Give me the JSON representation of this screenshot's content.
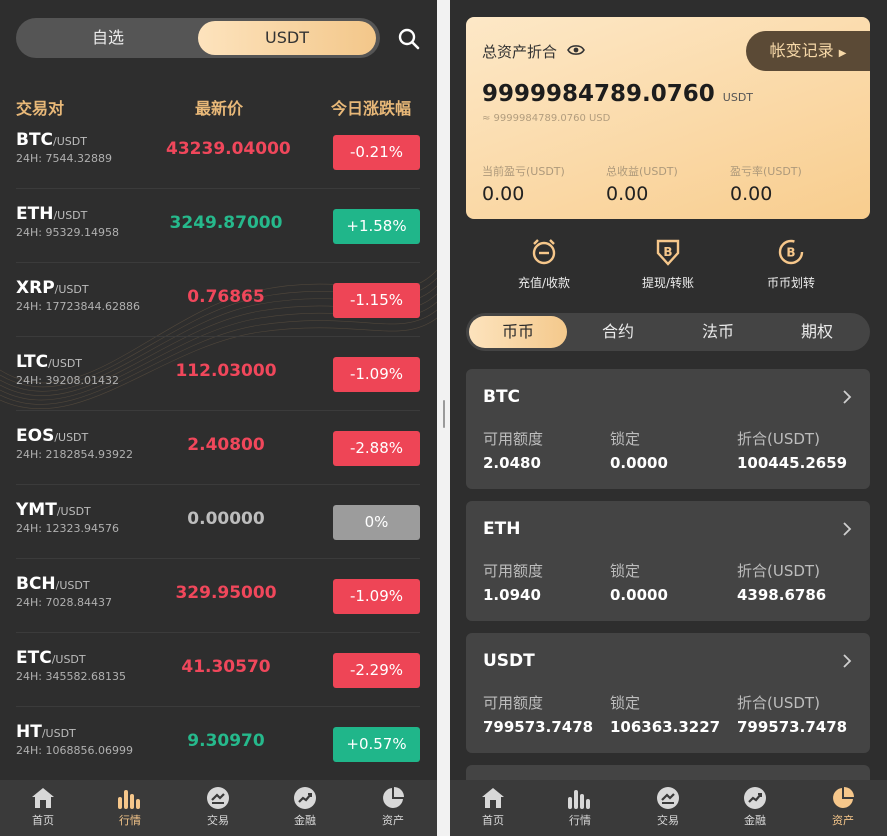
{
  "market": {
    "toggle": [
      "自选",
      "USDT"
    ],
    "headers": [
      "交易对",
      "最新价",
      "今日涨跌幅"
    ],
    "rows": [
      {
        "base": "BTC",
        "quote": "/USDT",
        "vol": "24H: 7544.32889",
        "price": "43239.04000",
        "change": "-0.21%",
        "dir": "down"
      },
      {
        "base": "ETH",
        "quote": "/USDT",
        "vol": "24H: 95329.14958",
        "price": "3249.87000",
        "change": "+1.58%",
        "dir": "up"
      },
      {
        "base": "XRP",
        "quote": "/USDT",
        "vol": "24H: 17723844.62886",
        "price": "0.76865",
        "change": "-1.15%",
        "dir": "down"
      },
      {
        "base": "LTC",
        "quote": "/USDT",
        "vol": "24H: 39208.01432",
        "price": "112.03000",
        "change": "-1.09%",
        "dir": "down"
      },
      {
        "base": "EOS",
        "quote": "/USDT",
        "vol": "24H: 2182854.93922",
        "price": "2.40800",
        "change": "-2.88%",
        "dir": "down"
      },
      {
        "base": "YMT",
        "quote": "/USDT",
        "vol": "24H: 12323.94576",
        "price": "0.00000",
        "change": "0%",
        "dir": "flat"
      },
      {
        "base": "BCH",
        "quote": "/USDT",
        "vol": "24H: 7028.84437",
        "price": "329.95000",
        "change": "-1.09%",
        "dir": "down"
      },
      {
        "base": "ETC",
        "quote": "/USDT",
        "vol": "24H: 345582.68135",
        "price": "41.30570",
        "change": "-2.29%",
        "dir": "down"
      },
      {
        "base": "HT",
        "quote": "/USDT",
        "vol": "24H: 1068856.06999",
        "price": "9.30970",
        "change": "+0.57%",
        "dir": "up"
      }
    ]
  },
  "nav": [
    "首页",
    "行情",
    "交易",
    "金融",
    "资产"
  ],
  "assets": {
    "title": "总资产折合",
    "record_button": "帐变记录",
    "total": "9999984789.0760",
    "total_unit": "USDT",
    "approx": "≈ 9999984789.0760 USD",
    "stats": [
      {
        "label": "当前盈亏(USDT)",
        "value": "0.00"
      },
      {
        "label": "总收益(USDT)",
        "value": "0.00"
      },
      {
        "label": "盈亏率(USDT)",
        "value": "0.00"
      }
    ],
    "actions": [
      "充值/收款",
      "提现/转账",
      "币币划转"
    ],
    "tabs": [
      "币币",
      "合约",
      "法币",
      "期权"
    ],
    "col_labels": [
      "可用额度",
      "锁定",
      "折合(USDT)"
    ],
    "coins": [
      {
        "name": "BTC",
        "available": "2.0480",
        "locked": "0.0000",
        "converted": "100445.2659"
      },
      {
        "name": "ETH",
        "available": "1.0940",
        "locked": "0.0000",
        "converted": "4398.6786"
      },
      {
        "name": "USDT",
        "available": "799573.7478",
        "locked": "106363.3227",
        "converted": "799573.7478"
      }
    ]
  },
  "colors": {
    "up": "#20b68a",
    "down": "#ee4556",
    "accent": "#f6c78b"
  }
}
